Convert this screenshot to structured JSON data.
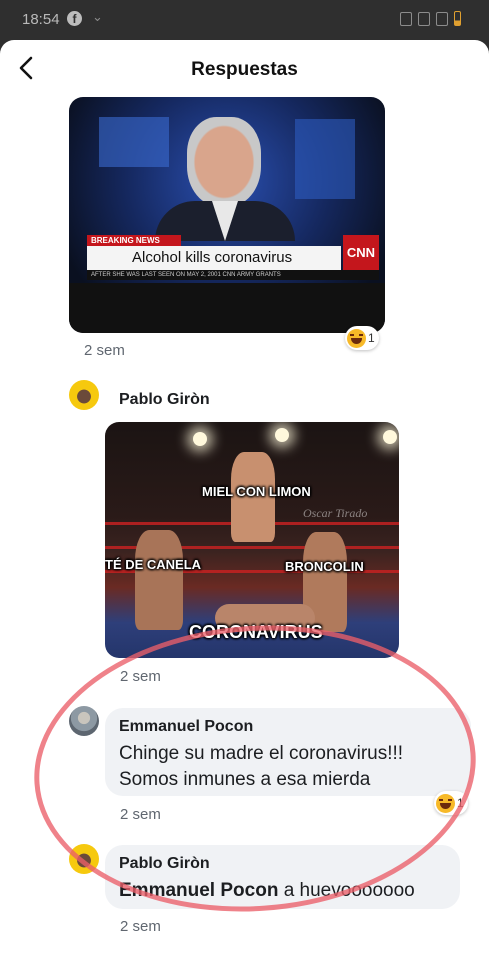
{
  "status_bar": {
    "time": "18:54",
    "notification_icon": "facebook-icon",
    "system_icons": [
      "mute-icon",
      "wifi-icon",
      "signal-icon",
      "battery-icon"
    ]
  },
  "header": {
    "title": "Respuestas",
    "back_icon": "chevron-left-icon"
  },
  "thread": [
    {
      "type": "image-reply",
      "image": {
        "breaking": "BREAKING NEWS",
        "headline": "Alcohol kills coronavirus",
        "network": "CNN",
        "ticker": "AFTER SHE WAS LAST SEEN ON MAY 2, 2001   CNN   ARMY GRANTS"
      },
      "time": "2 sem",
      "reaction": {
        "icon": "haha-emoji-icon",
        "count": "1"
      }
    },
    {
      "type": "image-reply",
      "author": "Pablo Giròn",
      "image": {
        "labels": [
          "MIEL CON LIMON",
          "TÉ DE CANELA",
          "BRONCOLIN",
          "CORONAVIRUS"
        ],
        "watermark": "Oscar Tirado"
      },
      "time": "2 sem"
    },
    {
      "type": "text-reply",
      "author": "Emmanuel Pocon",
      "text_line1": "Chinge su madre el coronavirus!!!",
      "text_line2": "Somos inmunes a esa mierda",
      "time": "2 sem",
      "reaction": {
        "icon": "haha-emoji-icon",
        "count": "1"
      }
    },
    {
      "type": "text-reply",
      "author": "Pablo Giròn",
      "mention": "Emmanuel Pocon",
      "text": " a huevooooooo",
      "time": "2 sem"
    }
  ],
  "colors": {
    "annotation_circle": "#eb5f69",
    "bubble": "#f0f2f5",
    "secondary_text": "#606770"
  }
}
